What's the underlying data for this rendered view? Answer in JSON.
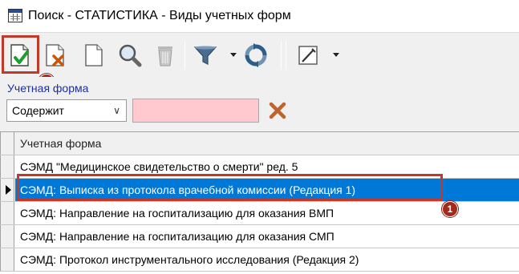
{
  "window": {
    "title": "Поиск - СТАТИСТИКА - Виды учетных форм"
  },
  "toolbar": {
    "buttons": [
      {
        "name": "select-confirm-button",
        "icon": "document-check-icon"
      },
      {
        "name": "delete-record-button",
        "icon": "document-x-icon"
      },
      {
        "name": "new-document-button",
        "icon": "blank-document-icon"
      },
      {
        "name": "search-button",
        "icon": "magnifier-icon"
      },
      {
        "name": "trash-button",
        "icon": "trash-icon"
      },
      {
        "name": "filter-button",
        "icon": "funnel-icon"
      },
      {
        "name": "refresh-button",
        "icon": "refresh-icon"
      },
      {
        "name": "edit-button",
        "icon": "pencil-frame-icon"
      }
    ],
    "badge_2": "2"
  },
  "filter": {
    "label": "Учетная форма",
    "condition": "Содержит",
    "value": ""
  },
  "grid": {
    "column_header": "Учетная форма",
    "rows": [
      "СЭМД \"Медицинское свидетельство о смерти\" ред. 5",
      "СЭМД: Выписка из протокола врачебной комиссии (Редакция 1)",
      "СЭМД: Направление на госпитализацию для оказания ВМП",
      "СЭМД: Направление на госпитализацию для оказания СМП",
      "СЭМД: Протокол инструментального исследования (Редакция 2)"
    ],
    "selected_index": 1,
    "badge_1": "1"
  },
  "colors": {
    "selection": "#0078d7",
    "highlight": "#c0392b",
    "filter_input_bg": "#ffc9cf",
    "label_blue": "#1a2fa0"
  }
}
